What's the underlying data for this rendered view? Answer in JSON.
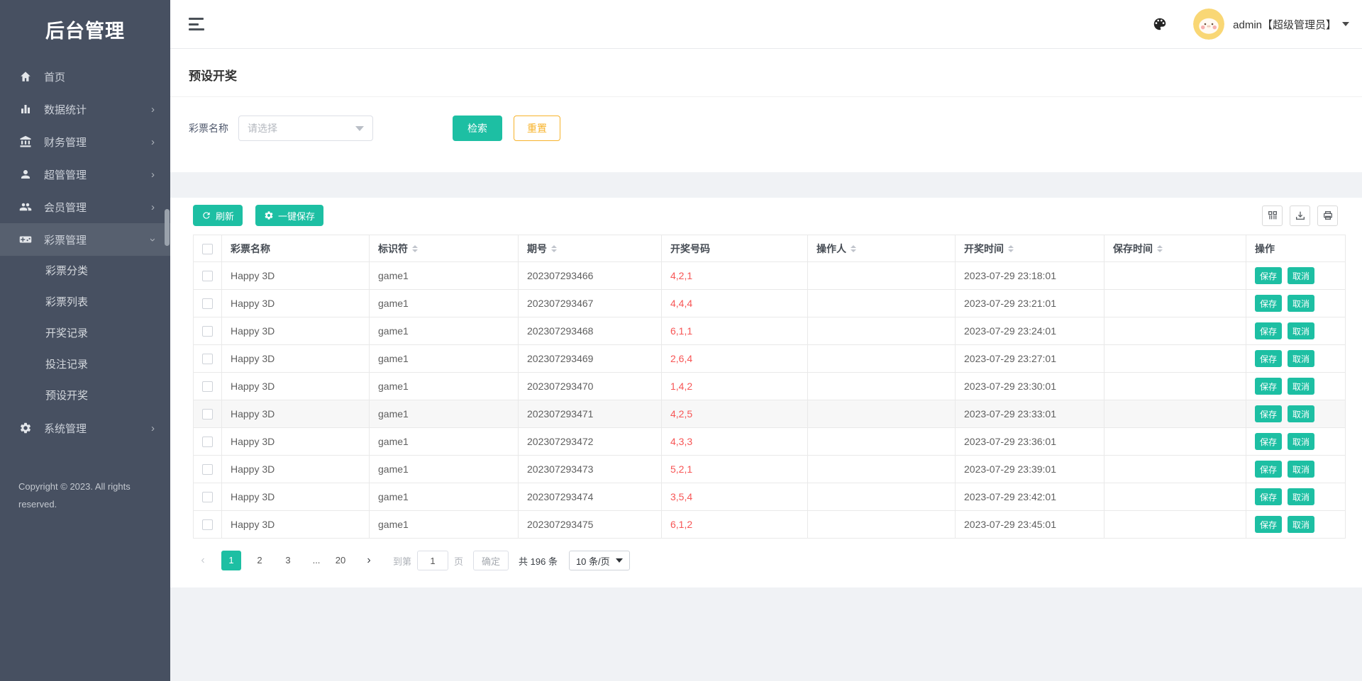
{
  "app": {
    "title": "后台管理",
    "copyright": "Copyright © 2023. All rights reserved."
  },
  "header": {
    "user": "admin【超级管理员】"
  },
  "colors": {
    "accent": "#1dbfa3",
    "warning": "#f7b32b",
    "danger": "#f75555",
    "sidebar_bg": "#475061",
    "sidebar_active_bg": "#57606f"
  },
  "sidebar": {
    "items": [
      {
        "id": "home",
        "icon": "home",
        "label": "首页"
      },
      {
        "id": "stats",
        "icon": "bar-chart",
        "label": "数据统计",
        "chevron": "right"
      },
      {
        "id": "finance",
        "icon": "bank",
        "label": "财务管理",
        "chevron": "right"
      },
      {
        "id": "admins",
        "icon": "user",
        "label": "超管管理",
        "chevron": "right"
      },
      {
        "id": "members",
        "icon": "users",
        "label": "会员管理",
        "chevron": "right"
      },
      {
        "id": "lottery",
        "icon": "gamepad",
        "label": "彩票管理",
        "chevron": "down",
        "active": true,
        "children": [
          "彩票分类",
          "彩票列表",
          "开奖记录",
          "投注记录",
          "预设开奖"
        ]
      },
      {
        "id": "system",
        "icon": "gear",
        "label": "系统管理",
        "chevron": "right"
      }
    ]
  },
  "page": {
    "title": "预设开奖"
  },
  "filter": {
    "label": "彩票名称",
    "placeholder": "请选择",
    "search_label": "检索",
    "reset_label": "重置"
  },
  "toolbar": {
    "refresh_label": "刷新",
    "save_all_label": "一键保存"
  },
  "table": {
    "headers": [
      {
        "key": "select",
        "type": "checkbox",
        "label": "",
        "sortable": false
      },
      {
        "key": "name",
        "label": "彩票名称",
        "sortable": false
      },
      {
        "key": "code",
        "label": "标识符",
        "sortable": true
      },
      {
        "key": "issue",
        "label": "期号",
        "sortable": true
      },
      {
        "key": "result",
        "label": "开奖号码",
        "sortable": false
      },
      {
        "key": "operator",
        "label": "操作人",
        "sortable": true
      },
      {
        "key": "draw_time",
        "label": "开奖时间",
        "sortable": true
      },
      {
        "key": "save_time",
        "label": "保存时间",
        "sortable": true
      },
      {
        "key": "actions",
        "label": "操作",
        "sortable": false
      }
    ],
    "action_labels": {
      "save": "保存",
      "cancel": "取消"
    },
    "rows": [
      {
        "name": "Happy 3D",
        "code": "game1",
        "issue": "202307293466",
        "result": "4,2,1",
        "operator": "",
        "draw_time": "2023-07-29 23:18:01",
        "save_time": ""
      },
      {
        "name": "Happy 3D",
        "code": "game1",
        "issue": "202307293467",
        "result": "4,4,4",
        "operator": "",
        "draw_time": "2023-07-29 23:21:01",
        "save_time": ""
      },
      {
        "name": "Happy 3D",
        "code": "game1",
        "issue": "202307293468",
        "result": "6,1,1",
        "operator": "",
        "draw_time": "2023-07-29 23:24:01",
        "save_time": ""
      },
      {
        "name": "Happy 3D",
        "code": "game1",
        "issue": "202307293469",
        "result": "2,6,4",
        "operator": "",
        "draw_time": "2023-07-29 23:27:01",
        "save_time": ""
      },
      {
        "name": "Happy 3D",
        "code": "game1",
        "issue": "202307293470",
        "result": "1,4,2",
        "operator": "",
        "draw_time": "2023-07-29 23:30:01",
        "save_time": ""
      },
      {
        "name": "Happy 3D",
        "code": "game1",
        "issue": "202307293471",
        "result": "4,2,5",
        "operator": "",
        "draw_time": "2023-07-29 23:33:01",
        "save_time": "",
        "highlighted": true
      },
      {
        "name": "Happy 3D",
        "code": "game1",
        "issue": "202307293472",
        "result": "4,3,3",
        "operator": "",
        "draw_time": "2023-07-29 23:36:01",
        "save_time": ""
      },
      {
        "name": "Happy 3D",
        "code": "game1",
        "issue": "202307293473",
        "result": "5,2,1",
        "operator": "",
        "draw_time": "2023-07-29 23:39:01",
        "save_time": ""
      },
      {
        "name": "Happy 3D",
        "code": "game1",
        "issue": "202307293474",
        "result": "3,5,4",
        "operator": "",
        "draw_time": "2023-07-29 23:42:01",
        "save_time": ""
      },
      {
        "name": "Happy 3D",
        "code": "game1",
        "issue": "202307293475",
        "result": "6,1,2",
        "operator": "",
        "draw_time": "2023-07-29 23:45:01",
        "save_time": ""
      }
    ]
  },
  "pagination": {
    "pages": [
      {
        "label": "‹",
        "type": "prev",
        "disabled": true
      },
      {
        "label": "1",
        "active": true
      },
      {
        "label": "2"
      },
      {
        "label": "3"
      },
      {
        "label": "...",
        "type": "ellipsis"
      },
      {
        "label": "20"
      },
      {
        "label": "›",
        "type": "next"
      }
    ],
    "jump_prefix": "到第",
    "jump_value": "1",
    "jump_suffix": "页",
    "confirm_label": "确定",
    "total_label": "共 196 条",
    "page_size_label": "10 条/页"
  }
}
